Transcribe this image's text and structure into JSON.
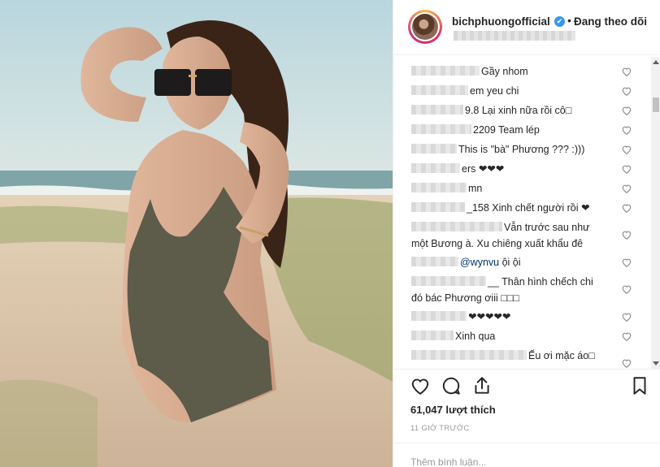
{
  "post": {
    "username": "bichphuongofficial",
    "verified_mark": "✔",
    "separator": "•",
    "follow_label": "Đang theo dõi",
    "likes": "61,047 lượt thích",
    "time": "11 GIỜ TRƯỚC",
    "add_comment_placeholder": "Thêm bình luận..."
  },
  "comments": [
    {
      "text": "Gầy nhom"
    },
    {
      "text": "em yeu chi"
    },
    {
      "text": "9.8 Lại xinh nữa rồi cô□"
    },
    {
      "text": "2209 Team lép"
    },
    {
      "text": "This is \"bà\" Phương ??? :)))"
    },
    {
      "text": "ers ❤❤❤"
    },
    {
      "text": "mn"
    },
    {
      "text": "_158 Xinh chết người rồi ❤"
    },
    {
      "text": "Vẫn trước sau như",
      "line2": "một Bương à. Xu chiêng xuất khẩu đê"
    },
    {
      "mention": "@wynvu",
      "text": "ội ội"
    },
    {
      "text": "__ Thân hình chếch chi",
      "line2": "đó bác Phương ơiii □□□"
    },
    {
      "text": "❤❤❤❤❤"
    },
    {
      "text": "Xinh qua"
    },
    {
      "text": "Ếu ơi mặc áo□"
    }
  ],
  "icons": {
    "heart": "heart-icon",
    "comment": "comment-icon",
    "share": "share-icon",
    "save": "bookmark-icon"
  },
  "colors": {
    "accent": "#3897f0",
    "text": "#262626",
    "muted": "#999999"
  }
}
